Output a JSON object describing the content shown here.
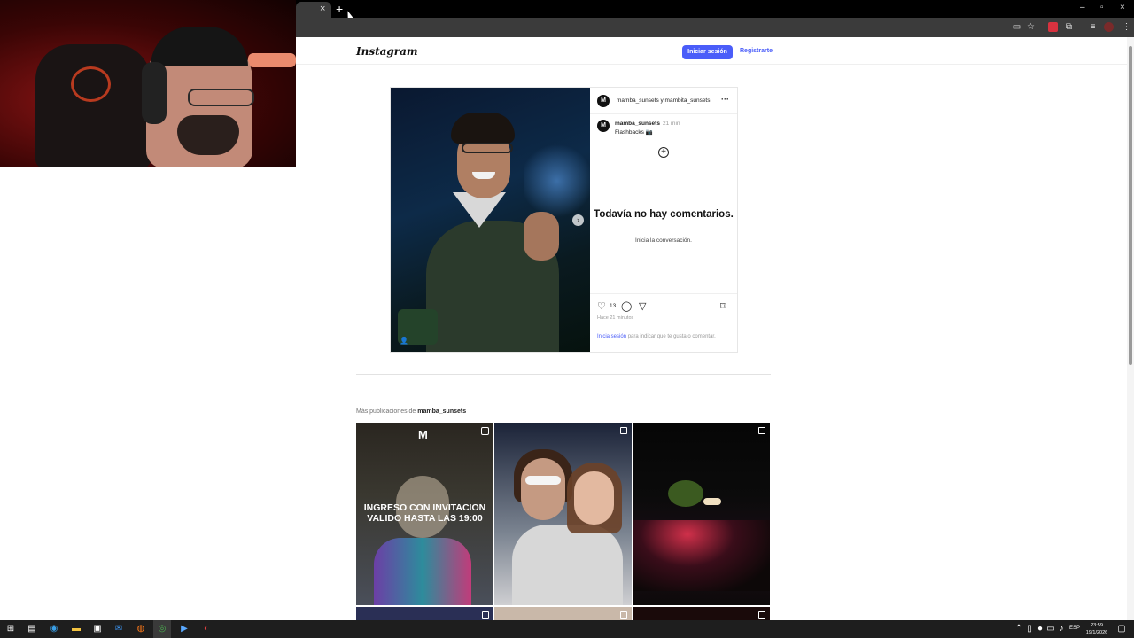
{
  "browser": {
    "tab_close": "×",
    "new_tab": "+",
    "window_controls": [
      "–",
      "▫",
      "×"
    ]
  },
  "instagram": {
    "logo": "Instagram",
    "login_button": "Iniciar sesión",
    "signup_link": "Registrarte",
    "post": {
      "header_users": "mamba_sunsets y mambita_sunsets",
      "header_more": "···",
      "avatar_letter": "M",
      "caption_user": "mamba_sunsets",
      "caption_time": "21 min",
      "caption_text": "Flashbacks 📷",
      "add_icon": "+",
      "no_comments": "Todavía no hay comentarios.",
      "start_conversation": "Inicia la conversación.",
      "like_count": "13",
      "posted_time": "Hace 21 minutos",
      "login_prompt_link": "Inicia sesión",
      "login_prompt_rest": " para indicar que te gusta o comentar."
    },
    "more_posts_prefix": "Más publicaciones de ",
    "more_posts_user": "mamba_sunsets",
    "grid_posts": [
      {
        "brand": "M",
        "overlay_text": "INGRESO CON INVITACION VALIDO HASTA LAS 19:00",
        "type": "reel"
      },
      {
        "overlay_text": "",
        "type": "carousel"
      },
      {
        "overlay_text": "",
        "type": "carousel"
      }
    ]
  },
  "taskbar": {
    "language": "ESP",
    "time": "23:59",
    "date": "19/1/2026"
  },
  "colors": {
    "accent": "#4a5df9",
    "browser_dark": "#3b3b3b",
    "taskbar": "#1e1e1e"
  }
}
